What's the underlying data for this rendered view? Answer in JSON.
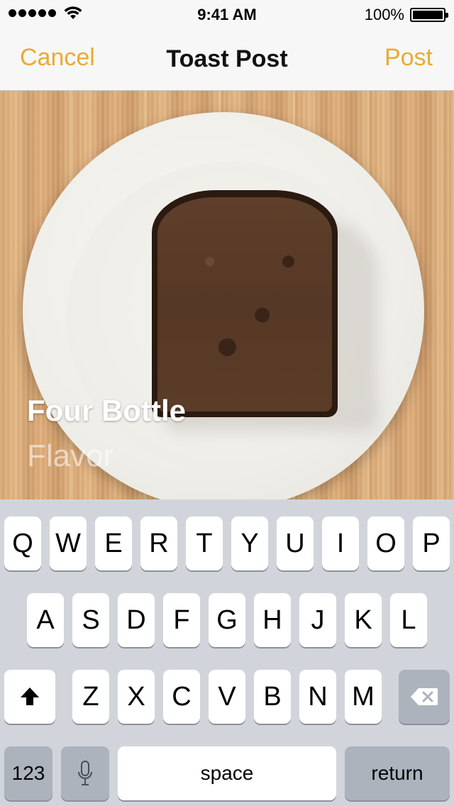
{
  "status_bar": {
    "time": "9:41 AM",
    "battery": "100%"
  },
  "nav": {
    "cancel": "Cancel",
    "title": "Toast Post",
    "post": "Post"
  },
  "photo": {
    "title": "Four Bottle",
    "subtitle": "Flavor"
  },
  "keyboard": {
    "row1": [
      "Q",
      "W",
      "E",
      "R",
      "T",
      "Y",
      "U",
      "I",
      "O",
      "P"
    ],
    "row2": [
      "A",
      "S",
      "D",
      "F",
      "G",
      "H",
      "J",
      "K",
      "L"
    ],
    "row3": [
      "Z",
      "X",
      "C",
      "V",
      "B",
      "N",
      "M"
    ],
    "numbers": "123",
    "space": "space",
    "return": "return"
  },
  "colors": {
    "accent": "#eaaa36",
    "keyboard_bg": "#d1d5db",
    "dark_key": "#acb3bd"
  }
}
